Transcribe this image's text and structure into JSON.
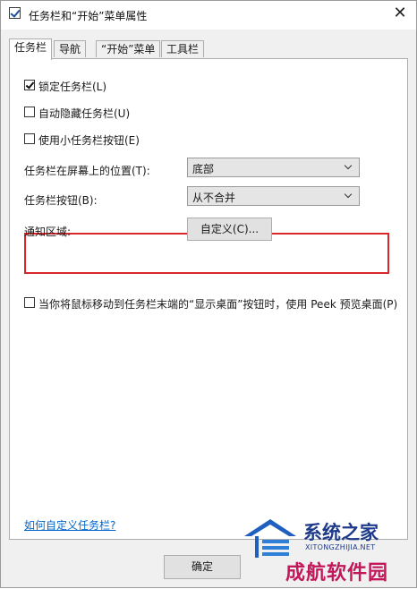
{
  "window": {
    "title": "任务栏和“开始”菜单属性",
    "close_glyph": "✕"
  },
  "tabs": [
    {
      "label": "任务栏",
      "active": true
    },
    {
      "label": "导航",
      "active": false
    },
    {
      "label": "“开始”菜单",
      "active": false
    },
    {
      "label": "工具栏",
      "active": false
    }
  ],
  "options": {
    "lock_taskbar": {
      "label": "锁定任务栏(L)",
      "checked": true
    },
    "auto_hide": {
      "label": "自动隐藏任务栏(U)",
      "checked": false
    },
    "small_buttons": {
      "label": "使用小任务栏按钮(E)",
      "checked": false
    },
    "peek": {
      "label": "当你将鼠标移动到任务栏末端的“显示桌面”按钮时，使用 Peek 预览桌面(P)",
      "checked": false
    }
  },
  "location": {
    "label": "任务栏在屏幕上的位置(T):",
    "value": "底部"
  },
  "buttons_combine": {
    "label": "任务栏按钮(B):",
    "value": "从不合并"
  },
  "notification": {
    "label": "通知区域:",
    "button": "自定义(C)..."
  },
  "help_link": "如何自定义任务栏?",
  "footer": {
    "ok_label": "确定"
  },
  "watermark": {
    "top_text": "系统之家",
    "url_text": "XITONGZHIJIA.NET",
    "bottom_text": "成航软件园"
  },
  "colors": {
    "highlight": "#d9262c",
    "link": "#0066cc",
    "watermark_blue": "#1e3a8a",
    "watermark_pink": "#c2185b"
  }
}
